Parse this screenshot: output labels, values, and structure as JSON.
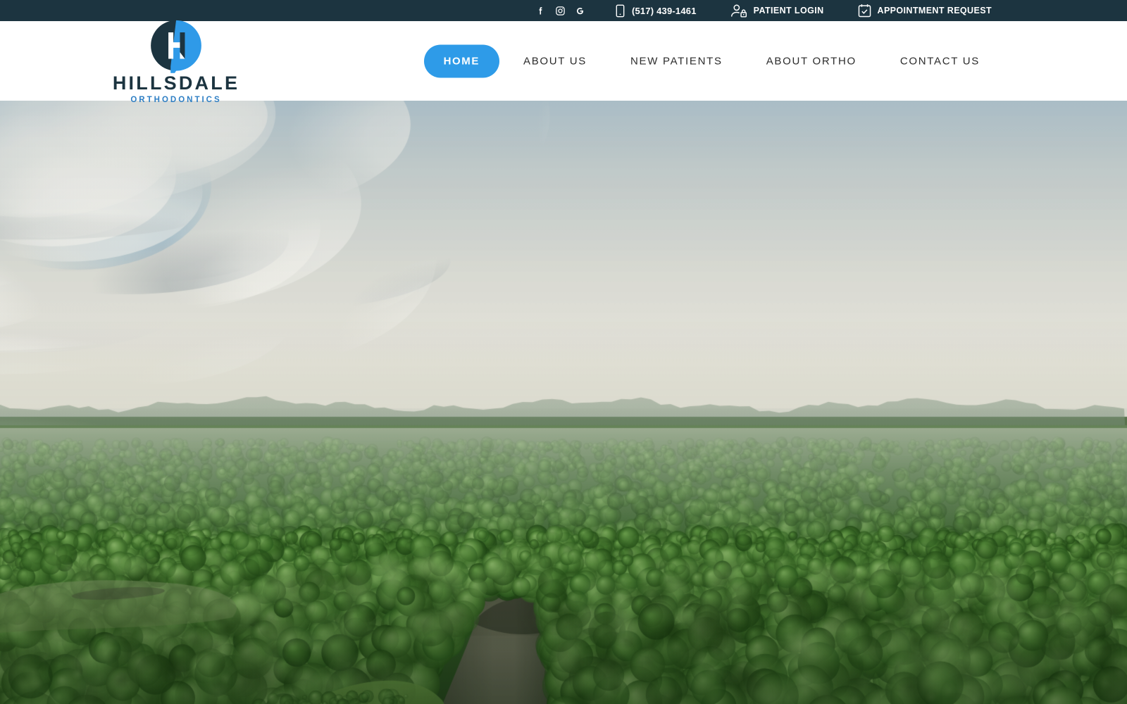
{
  "topbar": {
    "background_color": "#1c3440",
    "social": [
      {
        "name": "facebook-icon",
        "label": "Facebook"
      },
      {
        "name": "instagram-icon",
        "label": "Instagram"
      },
      {
        "name": "google-icon",
        "label": "Google"
      }
    ],
    "phone": {
      "icon": "mobile-phone-icon",
      "number": "(517) 439-1461"
    },
    "patient_login": {
      "icon": "user-lock-icon",
      "label": "PATIENT LOGIN"
    },
    "appointment_request": {
      "icon": "calendar-check-icon",
      "label": "APPOINTMENT REQUEST"
    }
  },
  "logo": {
    "mark": "hillsdale-h-circle-mark",
    "wordmark": "HILLSDALE",
    "tagline": "ORTHODONTICS",
    "dark_color": "#1c3440",
    "blue_color": "#2f9ae8",
    "tagline_color": "#2f7fc4"
  },
  "nav": {
    "accent_color": "#2e9be8",
    "items": [
      {
        "label": "HOME",
        "active": true
      },
      {
        "label": "ABOUT US",
        "active": false
      },
      {
        "label": "NEW PATIENTS",
        "active": false
      },
      {
        "label": "ABOUT ORTHO",
        "active": false
      },
      {
        "label": "CONTACT US",
        "active": false
      }
    ]
  },
  "hero": {
    "name": "aerial-landscape-hero",
    "description": "Aerial drone view of a green forested river valley with a distant town skyline under a cloudy sky",
    "sky_color": "#d8dcd6",
    "cloud_color": "#f2f1ec",
    "forest_color": "#3d6b2e",
    "river_color": "#6b6a55"
  }
}
